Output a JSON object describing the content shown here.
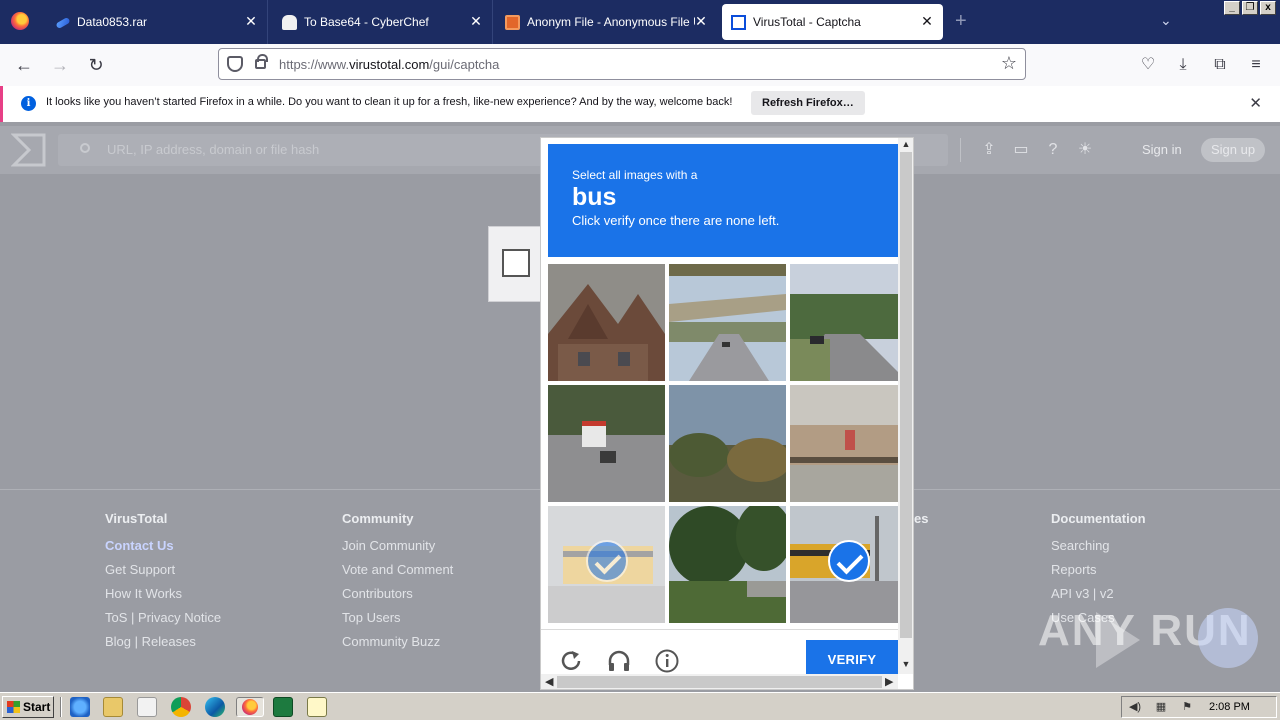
{
  "browser": {
    "tabs": [
      {
        "title": "Data0853.rar",
        "active": false
      },
      {
        "title": "To Base64 - CyberChef",
        "active": false
      },
      {
        "title": "Anonym File - Anonymous File Uplo",
        "active": false
      },
      {
        "title": "VirusTotal - Captcha",
        "active": true
      }
    ],
    "url_prefix": "https://www.",
    "url_host": "virustotal.com",
    "url_path": "/gui/captcha"
  },
  "notification": {
    "message": "It looks like you haven’t started Firefox in a while. Do you want to clean it up for a fresh, like-new experience? And by the way, welcome back!",
    "button_label": "Refresh Firefox…"
  },
  "vt": {
    "search_placeholder": "URL, IP address, domain or file hash",
    "sign_in": "Sign in",
    "sign_up": "Sign up",
    "footer": [
      {
        "heading": "VirusTotal",
        "links": [
          "Contact Us",
          "Get Support",
          "How It Works",
          "ToS | Privacy Notice",
          "Blog | Releases"
        ]
      },
      {
        "heading": "Community",
        "links": [
          "Join Community",
          "Vote and Comment",
          "Contributors",
          "Top Users",
          "Community Buzz"
        ]
      },
      {
        "heading": "es",
        "links": []
      },
      {
        "heading": "Documentation",
        "links": [
          "Searching",
          "Reports",
          "API v3 | v2",
          "Use Cases"
        ]
      }
    ]
  },
  "captcha": {
    "prompt_line1": "Select all images with a",
    "keyword": "bus",
    "prompt_line2": "Click verify once there are none left.",
    "verify_label": "VERIFY",
    "tiles": [
      {
        "name": "house-roof",
        "selected": false
      },
      {
        "name": "highway-overpass",
        "selected": false
      },
      {
        "name": "street-road",
        "selected": false
      },
      {
        "name": "bus-on-road",
        "selected": false
      },
      {
        "name": "trees-sky",
        "selected": false
      },
      {
        "name": "storefront-fence",
        "selected": false
      },
      {
        "name": "school-bus-faded",
        "selected": true
      },
      {
        "name": "trees-hillside",
        "selected": false
      },
      {
        "name": "school-bus-crossing",
        "selected": true
      }
    ]
  },
  "watermark": "ANY RUN",
  "taskbar": {
    "start_label": "Start",
    "clock": "2:08 PM"
  },
  "colors": {
    "tabbar": "#1c2c62",
    "captcha_blue": "#1a73e8",
    "accent_pink": "#e73f86"
  }
}
